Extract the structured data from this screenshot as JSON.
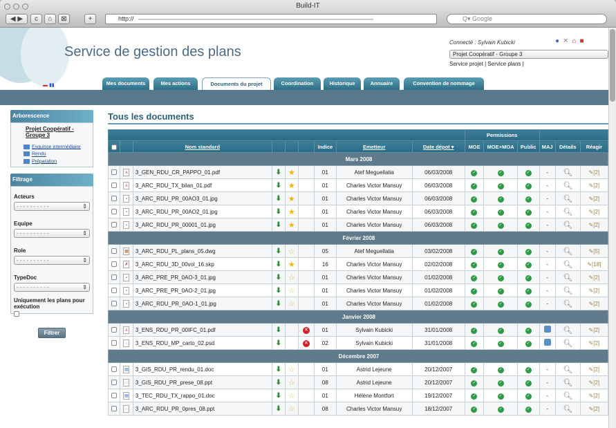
{
  "browser": {
    "title": "Build-IT",
    "url": "http://",
    "search_placeholder": "Q▾ Google"
  },
  "header": {
    "site_title": "Service de gestion des plans",
    "user": "Connecté : Sylvain Kubicki",
    "project_select": "Projet Coopératif - Groupe 3",
    "service_links": "Service projet | Service plans |"
  },
  "tabs": [
    "Mes documents",
    "Mes actions",
    "Documents du projet",
    "Coordination",
    "Historique",
    "Annuaire",
    "Convention de nommage"
  ],
  "sidebar": {
    "tree_title": "Arborescence",
    "project": "Projet Coopératif - Groupe 3",
    "folders": [
      "Esquisse intermédiaire",
      "Rendu",
      "Préparation"
    ],
    "filter_title": "Filtrage",
    "filters": [
      {
        "label": "Acteurs",
        "value": "- - - - - - - - - -"
      },
      {
        "label": "Equipe",
        "value": "- - - - - - - - - -"
      },
      {
        "label": "Role",
        "value": "- - - - - - - - - -"
      },
      {
        "label": "TypeDoc",
        "value": "- - - - - - - - - -"
      }
    ],
    "only_exec": "Uniquement les plans pour exécution",
    "button": "Filtrer"
  },
  "main": {
    "title": "Tous les documents",
    "columns": {
      "permissions": "Permissions",
      "nom": "Nom standard",
      "indice": "Indice",
      "emetteur": "Emetteur",
      "date": "Date dépot",
      "moe": "MOE",
      "moemoa": "MOE+MOA",
      "public": "Public",
      "maj": "MAJ",
      "details": "Détails",
      "reagir": "Réagir"
    },
    "groups": [
      {
        "label": "Mars 2008",
        "rows": [
          {
            "type": "pdf",
            "name": "3_GEN_RDU_CR_PAPPO_01.pdf",
            "star": "full",
            "del": false,
            "indice": "01",
            "emetteur": "Atef Meguellatia",
            "date": "06/03/2008",
            "maj": "-",
            "react": "[2]"
          },
          {
            "type": "pdf",
            "name": "3_ARC_RDU_TX_bilan_01.pdf",
            "star": "full",
            "del": false,
            "indice": "01",
            "emetteur": "Charles Victor Mansuy",
            "date": "06/03/2008",
            "maj": "-",
            "react": "[2]"
          },
          {
            "type": "jpg",
            "name": "3_ARC_RDU_PR_00AO3_01.jpg",
            "star": "full",
            "del": false,
            "indice": "01",
            "emetteur": "Charles Victor Mansuy",
            "date": "06/03/2008",
            "maj": "-",
            "react": "[2]"
          },
          {
            "type": "jpg",
            "name": "3_ARC_RDU_PR_00AO2_01.jpg",
            "star": "full",
            "del": false,
            "indice": "01",
            "emetteur": "Charles Victor Mansuy",
            "date": "06/03/2008",
            "maj": "-",
            "react": "[2]"
          },
          {
            "type": "jpg",
            "name": "3_ARC_RDU_PR_00001_01.jpg",
            "star": "full",
            "del": false,
            "indice": "01",
            "emetteur": "Charles Victor Mansuy",
            "date": "06/03/2008",
            "maj": "-",
            "react": "[2]"
          }
        ]
      },
      {
        "label": "Février 2008",
        "rows": [
          {
            "type": "dwg",
            "name": "3_ARC_RDU_PL_plans_05.dwg",
            "star": "empty",
            "del": false,
            "indice": "05",
            "emetteur": "Atef Meguellatia",
            "date": "03/02/2008",
            "maj": "-",
            "react": "[5]"
          },
          {
            "type": "skp",
            "name": "3_ARC_RDU_3D_00vol_16.skp",
            "star": "full",
            "del": false,
            "indice": "16",
            "emetteur": "Charles Victor Mansuy",
            "date": "02/02/2008",
            "maj": "-",
            "react": "[18]"
          },
          {
            "type": "jpg",
            "name": "3_ARC_PRE_PR_0AO-3_01.jpg",
            "star": "empty",
            "del": false,
            "indice": "01",
            "emetteur": "Charles Victor Mansuy",
            "date": "01/02/2008",
            "maj": "-",
            "react": "[2]"
          },
          {
            "type": "jpg",
            "name": "3_ARC_PRE_PR_0AO-2_01.jpg",
            "star": "empty",
            "del": false,
            "indice": "01",
            "emetteur": "Charles Victor Mansuy",
            "date": "01/02/2008",
            "maj": "-",
            "react": "[2]"
          },
          {
            "type": "jpg",
            "name": "3_ARC_RDU_PR_0AO-1_01.jpg",
            "star": "empty",
            "del": false,
            "indice": "01",
            "emetteur": "Charles Victor Mansuy",
            "date": "01/02/2008",
            "maj": "-",
            "react": "[2]"
          }
        ]
      },
      {
        "label": "Janvier 2008",
        "rows": [
          {
            "type": "pdf",
            "name": "3_ENS_RDU_PR_00IFC_01.pdf",
            "star": "none",
            "del": true,
            "indice": "01",
            "emetteur": "Sylvain Kubicki",
            "date": "31/01/2008",
            "maj": "icon",
            "react": "[2]"
          },
          {
            "type": "psd",
            "name": "3_ENS_RDU_MP_carto_02.psd",
            "star": "none",
            "del": true,
            "indice": "02",
            "emetteur": "Sylvain Kubicki",
            "date": "31/01/2008",
            "maj": "icon",
            "react": "[2]"
          }
        ]
      },
      {
        "label": "Décembre 2007",
        "rows": [
          {
            "type": "doc",
            "name": "3_GIS_RDU_PR_rendu_01.doc",
            "star": "empty",
            "del": false,
            "indice": "01",
            "emetteur": "Astrid Lejeune",
            "date": "20/12/2007",
            "maj": "-",
            "react": "[2]"
          },
          {
            "type": "ppt",
            "name": "3_GIS_RDU_PR_prese_08.ppt",
            "star": "empty",
            "del": false,
            "indice": "08",
            "emetteur": "Astrid Lejeune",
            "date": "20/12/2007",
            "maj": "-",
            "react": "[2]"
          },
          {
            "type": "doc",
            "name": "3_TEC_RDU_TX_rappo_01.doc",
            "star": "empty",
            "del": false,
            "indice": "01",
            "emetteur": "Hélène Montfort",
            "date": "19/12/2007",
            "maj": "-",
            "react": "[2]"
          },
          {
            "type": "ppt",
            "name": "3_ARC_RDU_PR_0pres_08.ppt",
            "star": "empty",
            "del": false,
            "indice": "08",
            "emetteur": "Charles Victor Mansuy",
            "date": "18/12/2007",
            "maj": "-",
            "react": "[2]"
          }
        ]
      }
    ]
  },
  "colors": {
    "accent": "#2d5f77",
    "band": "#597a8c",
    "ok": "#2f9a45",
    "delete": "#cc2222"
  }
}
